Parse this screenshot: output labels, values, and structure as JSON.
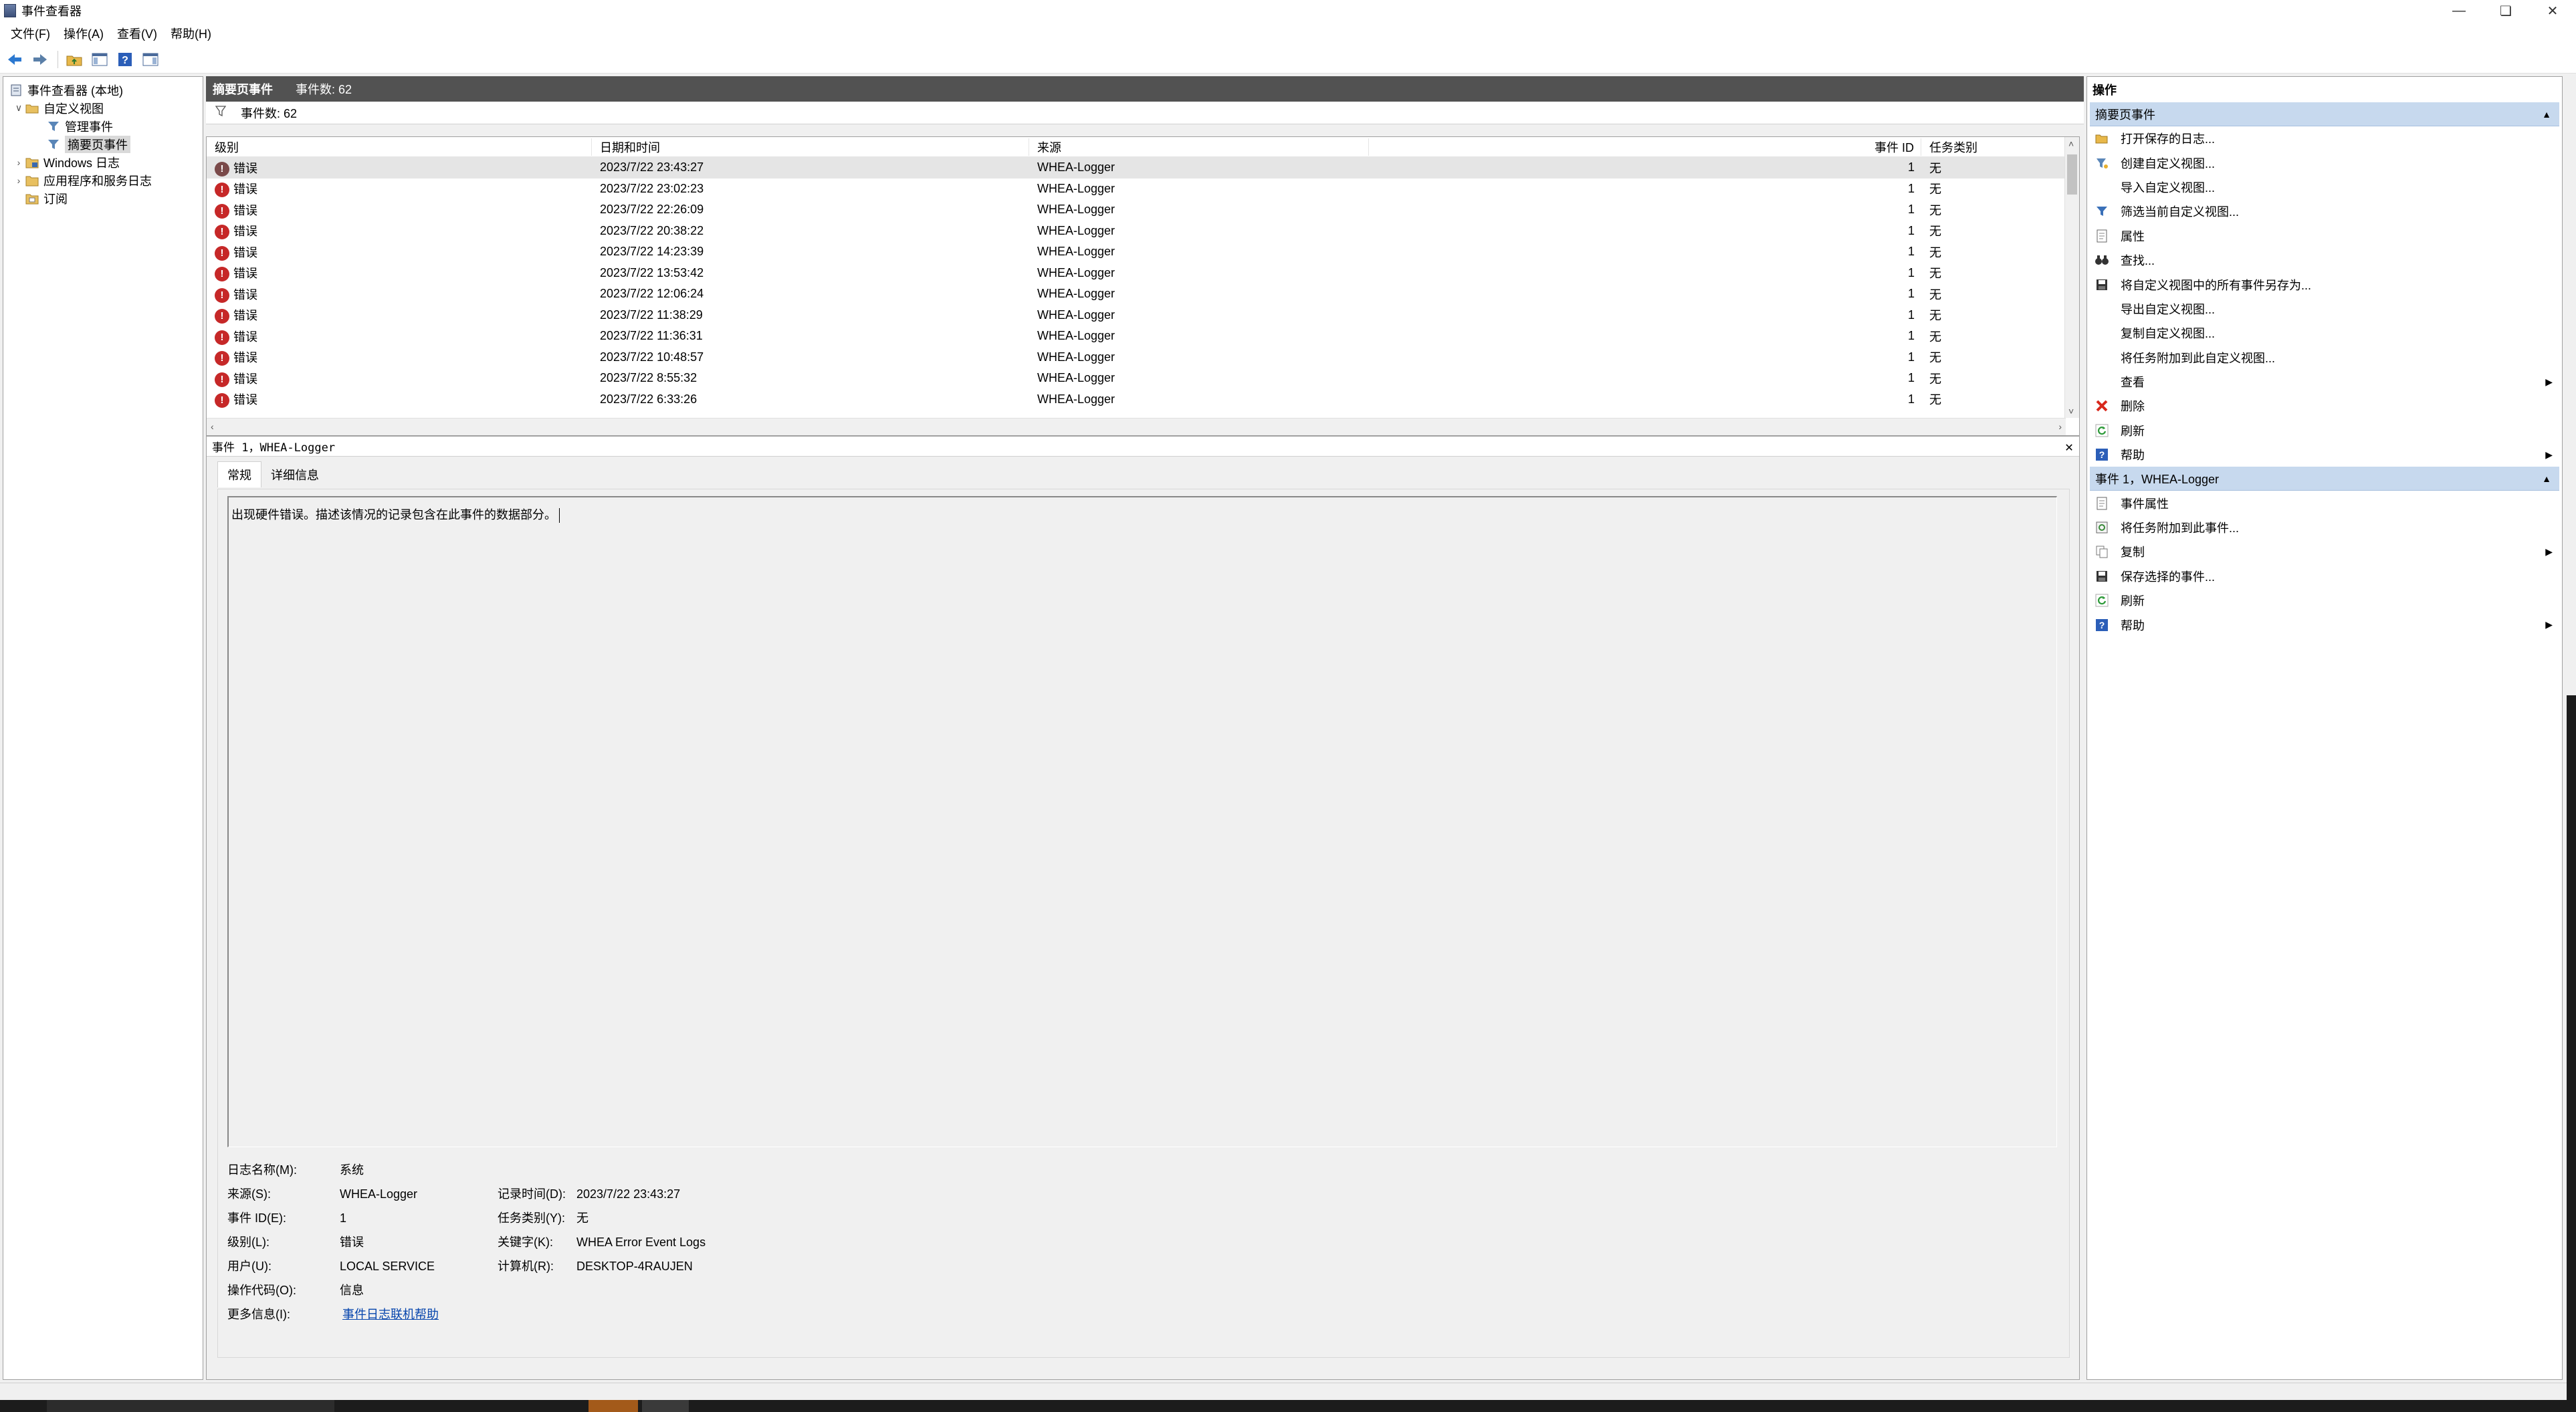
{
  "window": {
    "title": "事件查看器"
  },
  "menu": [
    "文件(F)",
    "操作(A)",
    "查看(V)",
    "帮助(H)"
  ],
  "toolbar": {
    "icons": [
      "back-arrow-icon",
      "forward-arrow-icon",
      "up-folder-icon",
      "show-hide-tree-icon",
      "help-icon",
      "show-hide-actions-icon"
    ]
  },
  "tree": {
    "root": "事件查看器 (本地)",
    "custom_views": "自定义视图",
    "admin_events": "管理事件",
    "summary_events": "摘要页事件",
    "windows_logs": "Windows 日志",
    "app_service_logs": "应用程序和服务日志",
    "subscriptions": "订阅"
  },
  "summary": {
    "title": "摘要页事件",
    "count_text": "事件数: 62",
    "filter_text": "事件数:  62"
  },
  "event_list": {
    "columns": {
      "level": "级别",
      "date": "日期和时间",
      "source": "来源",
      "event_id": "事件 ID",
      "task": "任务类别"
    },
    "rows": [
      {
        "level": "错误",
        "date": "2023/7/22 23:43:27",
        "source": "WHEA-Logger",
        "event_id": "1",
        "task": "无"
      },
      {
        "level": "错误",
        "date": "2023/7/22 23:02:23",
        "source": "WHEA-Logger",
        "event_id": "1",
        "task": "无"
      },
      {
        "level": "错误",
        "date": "2023/7/22 22:26:09",
        "source": "WHEA-Logger",
        "event_id": "1",
        "task": "无"
      },
      {
        "level": "错误",
        "date": "2023/7/22 20:38:22",
        "source": "WHEA-Logger",
        "event_id": "1",
        "task": "无"
      },
      {
        "level": "错误",
        "date": "2023/7/22 14:23:39",
        "source": "WHEA-Logger",
        "event_id": "1",
        "task": "无"
      },
      {
        "level": "错误",
        "date": "2023/7/22 13:53:42",
        "source": "WHEA-Logger",
        "event_id": "1",
        "task": "无"
      },
      {
        "level": "错误",
        "date": "2023/7/22 12:06:24",
        "source": "WHEA-Logger",
        "event_id": "1",
        "task": "无"
      },
      {
        "level": "错误",
        "date": "2023/7/22 11:38:29",
        "source": "WHEA-Logger",
        "event_id": "1",
        "task": "无"
      },
      {
        "level": "错误",
        "date": "2023/7/22 11:36:31",
        "source": "WHEA-Logger",
        "event_id": "1",
        "task": "无"
      },
      {
        "level": "错误",
        "date": "2023/7/22 10:48:57",
        "source": "WHEA-Logger",
        "event_id": "1",
        "task": "无"
      },
      {
        "level": "错误",
        "date": "2023/7/22 8:55:32",
        "source": "WHEA-Logger",
        "event_id": "1",
        "task": "无"
      },
      {
        "level": "错误",
        "date": "2023/7/22 6:33:26",
        "source": "WHEA-Logger",
        "event_id": "1",
        "task": "无"
      }
    ]
  },
  "detail": {
    "header": "事件 1，WHEA-Logger",
    "tabs": [
      "常规",
      "详细信息"
    ],
    "description": "出现硬件错误。描述该情况的记录包含在此事件的数据部分。",
    "props": {
      "log_name_label": "日志名称(M):",
      "log_name": "系统",
      "source_label": "来源(S):",
      "source": "WHEA-Logger",
      "logged_label": "记录时间(D):",
      "logged": "2023/7/22 23:43:27",
      "event_id_label": "事件 ID(E):",
      "event_id": "1",
      "task_label": "任务类别(Y):",
      "task": "无",
      "level_label": "级别(L):",
      "level": "错误",
      "keywords_label": "关键字(K):",
      "keywords": "WHEA Error Event Logs",
      "user_label": "用户(U):",
      "user": "LOCAL SERVICE",
      "computer_label": "计算机(R):",
      "computer": "DESKTOP-4RAUJEN",
      "opcode_label": "操作代码(O):",
      "opcode": "信息",
      "more_info_label": "更多信息(I):",
      "more_info_link": "事件日志联机帮助"
    }
  },
  "actions": {
    "title": "操作",
    "section1": {
      "title": "摘要页事件",
      "items": [
        {
          "label": "打开保存的日志...",
          "icon": "open-folder-icon"
        },
        {
          "label": "创建自定义视图...",
          "icon": "create-view-icon"
        },
        {
          "label": "导入自定义视图...",
          "icon": ""
        },
        {
          "label": "筛选当前自定义视图...",
          "icon": "filter-icon"
        },
        {
          "label": "属性",
          "icon": "properties-icon"
        },
        {
          "label": "查找...",
          "icon": "binoculars-icon"
        },
        {
          "label": "将自定义视图中的所有事件另存为...",
          "icon": "save-icon"
        },
        {
          "label": "导出自定义视图...",
          "icon": ""
        },
        {
          "label": "复制自定义视图...",
          "icon": ""
        },
        {
          "label": "将任务附加到此自定义视图...",
          "icon": ""
        },
        {
          "label": "查看",
          "icon": "",
          "submenu": true
        },
        {
          "label": "删除",
          "icon": "delete-icon"
        },
        {
          "label": "刷新",
          "icon": "refresh-icon"
        },
        {
          "label": "帮助",
          "icon": "help-icon",
          "submenu": true
        }
      ]
    },
    "section2": {
      "title": "事件 1，WHEA-Logger",
      "items": [
        {
          "label": "事件属性",
          "icon": "event-properties-icon"
        },
        {
          "label": "将任务附加到此事件...",
          "icon": "attach-task-icon"
        },
        {
          "label": "复制",
          "icon": "copy-icon",
          "submenu": true
        },
        {
          "label": "保存选择的事件...",
          "icon": "save-icon"
        },
        {
          "label": "刷新",
          "icon": "refresh-icon"
        },
        {
          "label": "帮助",
          "icon": "help-icon",
          "submenu": true
        }
      ]
    }
  },
  "colors": {
    "section_bg": "#c7d9ee",
    "header_dark": "#525252",
    "error_red": "#c62828",
    "link": "#0645ad"
  }
}
